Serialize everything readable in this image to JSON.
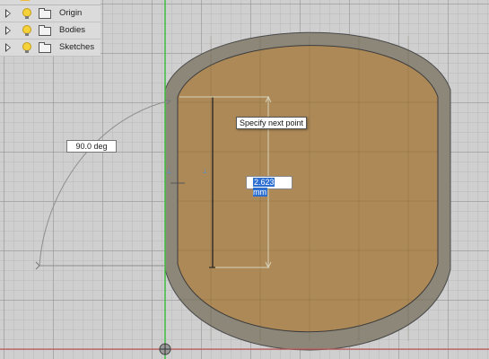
{
  "browser": {
    "items": [
      {
        "label": "Origin",
        "icon": "visibility-bulb-icon"
      },
      {
        "label": "Bodies",
        "icon": "visibility-bulb-icon"
      },
      {
        "label": "Sketches",
        "icon": "visibility-bulb-icon"
      }
    ]
  },
  "sketch": {
    "tooltip": "Specify next point",
    "angle_value": "90.0 deg",
    "dimension_value": "2.623 mm"
  },
  "colors": {
    "canvas_background": "#cfcfcf",
    "body_face": "#b08a53",
    "body_rim": "#8c8779",
    "y_axis": "#3fbf3f",
    "x_axis": "#c05a5a",
    "selection_highlight": "#2d6fd0"
  }
}
